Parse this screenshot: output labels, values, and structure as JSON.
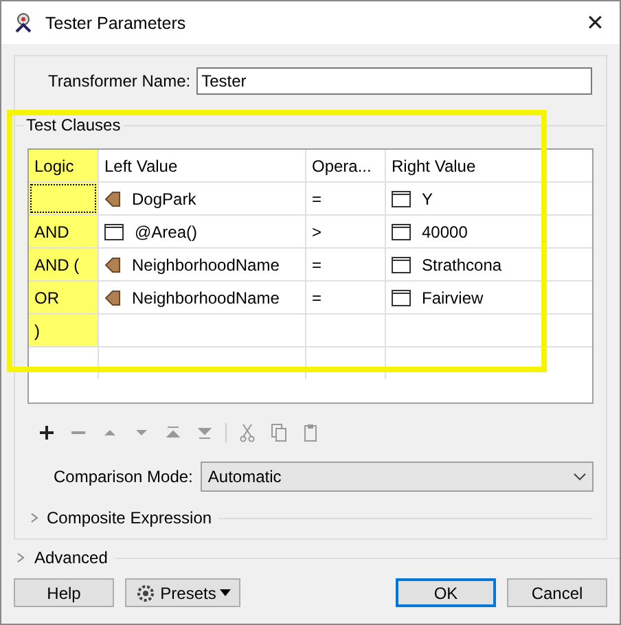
{
  "window": {
    "title": "Tester Parameters",
    "close": "✕"
  },
  "transformer_name": {
    "label": "Transformer Name:",
    "value": "Tester"
  },
  "test_clauses": {
    "title": "Test Clauses",
    "columns": [
      {
        "label": "Logic",
        "highlighted": true
      },
      {
        "label": "Left Value",
        "highlighted": false
      },
      {
        "label": "Opera...",
        "highlighted": false
      },
      {
        "label": "Right Value",
        "highlighted": false
      }
    ],
    "rows": [
      {
        "logic": "",
        "focused": true,
        "left": {
          "kind": "attribute",
          "text": "DogPark"
        },
        "operator": "=",
        "right": {
          "kind": "value",
          "text": "Y"
        }
      },
      {
        "logic": "AND",
        "focused": false,
        "left": {
          "kind": "function",
          "text": "@Area()"
        },
        "operator": ">",
        "right": {
          "kind": "value",
          "text": "40000"
        }
      },
      {
        "logic": "AND (",
        "focused": false,
        "left": {
          "kind": "attribute",
          "text": "NeighborhoodName"
        },
        "operator": "=",
        "right": {
          "kind": "value",
          "text": "Strathcona"
        }
      },
      {
        "logic": "OR",
        "focused": false,
        "left": {
          "kind": "attribute",
          "text": "NeighborhoodName"
        },
        "operator": "=",
        "right": {
          "kind": "value",
          "text": "Fairview"
        }
      },
      {
        "logic": ")",
        "focused": false
      }
    ],
    "toolbar": [
      {
        "kind": "add",
        "disabled": false
      },
      {
        "kind": "remove",
        "disabled": true
      },
      {
        "kind": "up",
        "disabled": true
      },
      {
        "kind": "down",
        "disabled": true
      },
      {
        "kind": "top",
        "disabled": true
      },
      {
        "kind": "bottom",
        "disabled": true
      },
      {
        "kind": "cut",
        "disabled": true
      },
      {
        "kind": "copy",
        "disabled": true
      },
      {
        "kind": "paste",
        "disabled": true
      }
    ],
    "comparison_mode": {
      "label": "Comparison Mode:",
      "value": "Automatic"
    },
    "composite_expression": {
      "label": "Composite Expression",
      "expanded": false
    }
  },
  "advanced": {
    "label": "Advanced",
    "expanded": false
  },
  "buttons": [
    {
      "kind": "help",
      "label": "Help",
      "default": false
    },
    {
      "kind": "presets",
      "label": "Presets",
      "default": false
    },
    {
      "kind": "ok",
      "label": "OK",
      "default": true
    },
    {
      "kind": "cancel",
      "label": "Cancel",
      "default": false
    }
  ],
  "highlight_frame": true
}
